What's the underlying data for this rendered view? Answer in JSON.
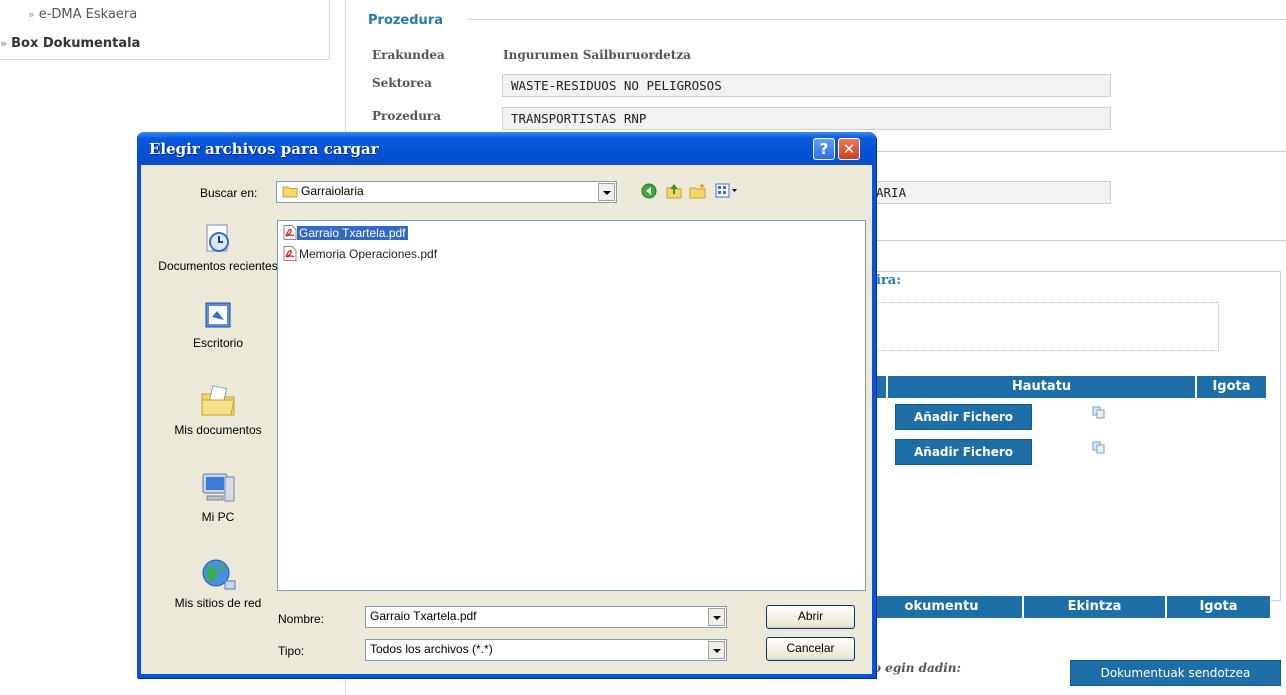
{
  "sidebar": {
    "items": [
      {
        "label": "e-DMA Eskaera"
      },
      {
        "label": "Box Dokumentala"
      }
    ]
  },
  "procedure": {
    "title": "Prozedura",
    "erakundea_label": "Erakundea",
    "erakundea_value": "Ingurumen Sailburuordetza",
    "sektorea_label": "Sektorea",
    "sektorea_value": "WASTE-RESIDUOS NO PELIGROSOS",
    "prozedura_label": "Prozedura",
    "prozedura_value": "TRANSPORTISTAS RNP"
  },
  "background": {
    "partial_field_value": "ARIA",
    "partial_heading": "ira:",
    "table1": {
      "headers": [
        "Hautatu",
        "Igota"
      ],
      "add_button": "Añadir Fichero"
    },
    "table2": {
      "headers": [
        "okumentu",
        "Ekintza",
        "Igota"
      ]
    },
    "footer_text": "o egin dadin:",
    "sign_button": "Dokumentuak sendotzea"
  },
  "dialog": {
    "title": "Elegir archivos para cargar",
    "help_glyph": "?",
    "close_glyph": "✕",
    "look_in_label": "Buscar en:",
    "look_in_value": "Garraiolaria",
    "places": [
      {
        "label": "Documentos recientes",
        "icon": "recent-documents-icon"
      },
      {
        "label": "Escritorio",
        "icon": "desktop-icon"
      },
      {
        "label": "Mis documentos",
        "icon": "my-documents-icon"
      },
      {
        "label": "Mi PC",
        "icon": "my-computer-icon"
      },
      {
        "label": "Mis sitios de red",
        "icon": "network-places-icon"
      }
    ],
    "files": [
      {
        "name": "Garraio Txartela.pdf",
        "selected": true
      },
      {
        "name": "Memoria Operaciones.pdf",
        "selected": false
      }
    ],
    "name_label": "Nombre:",
    "name_value": "Garraio Txartela.pdf",
    "type_label": "Tipo:",
    "type_value": "Todos los archivos (*.*)",
    "open_button": "Abrir",
    "cancel_button": "Cancelar"
  },
  "colors": {
    "accent_blue": "#1e6fa8",
    "xp_title": "#0452d8",
    "selection": "#316ac5"
  }
}
